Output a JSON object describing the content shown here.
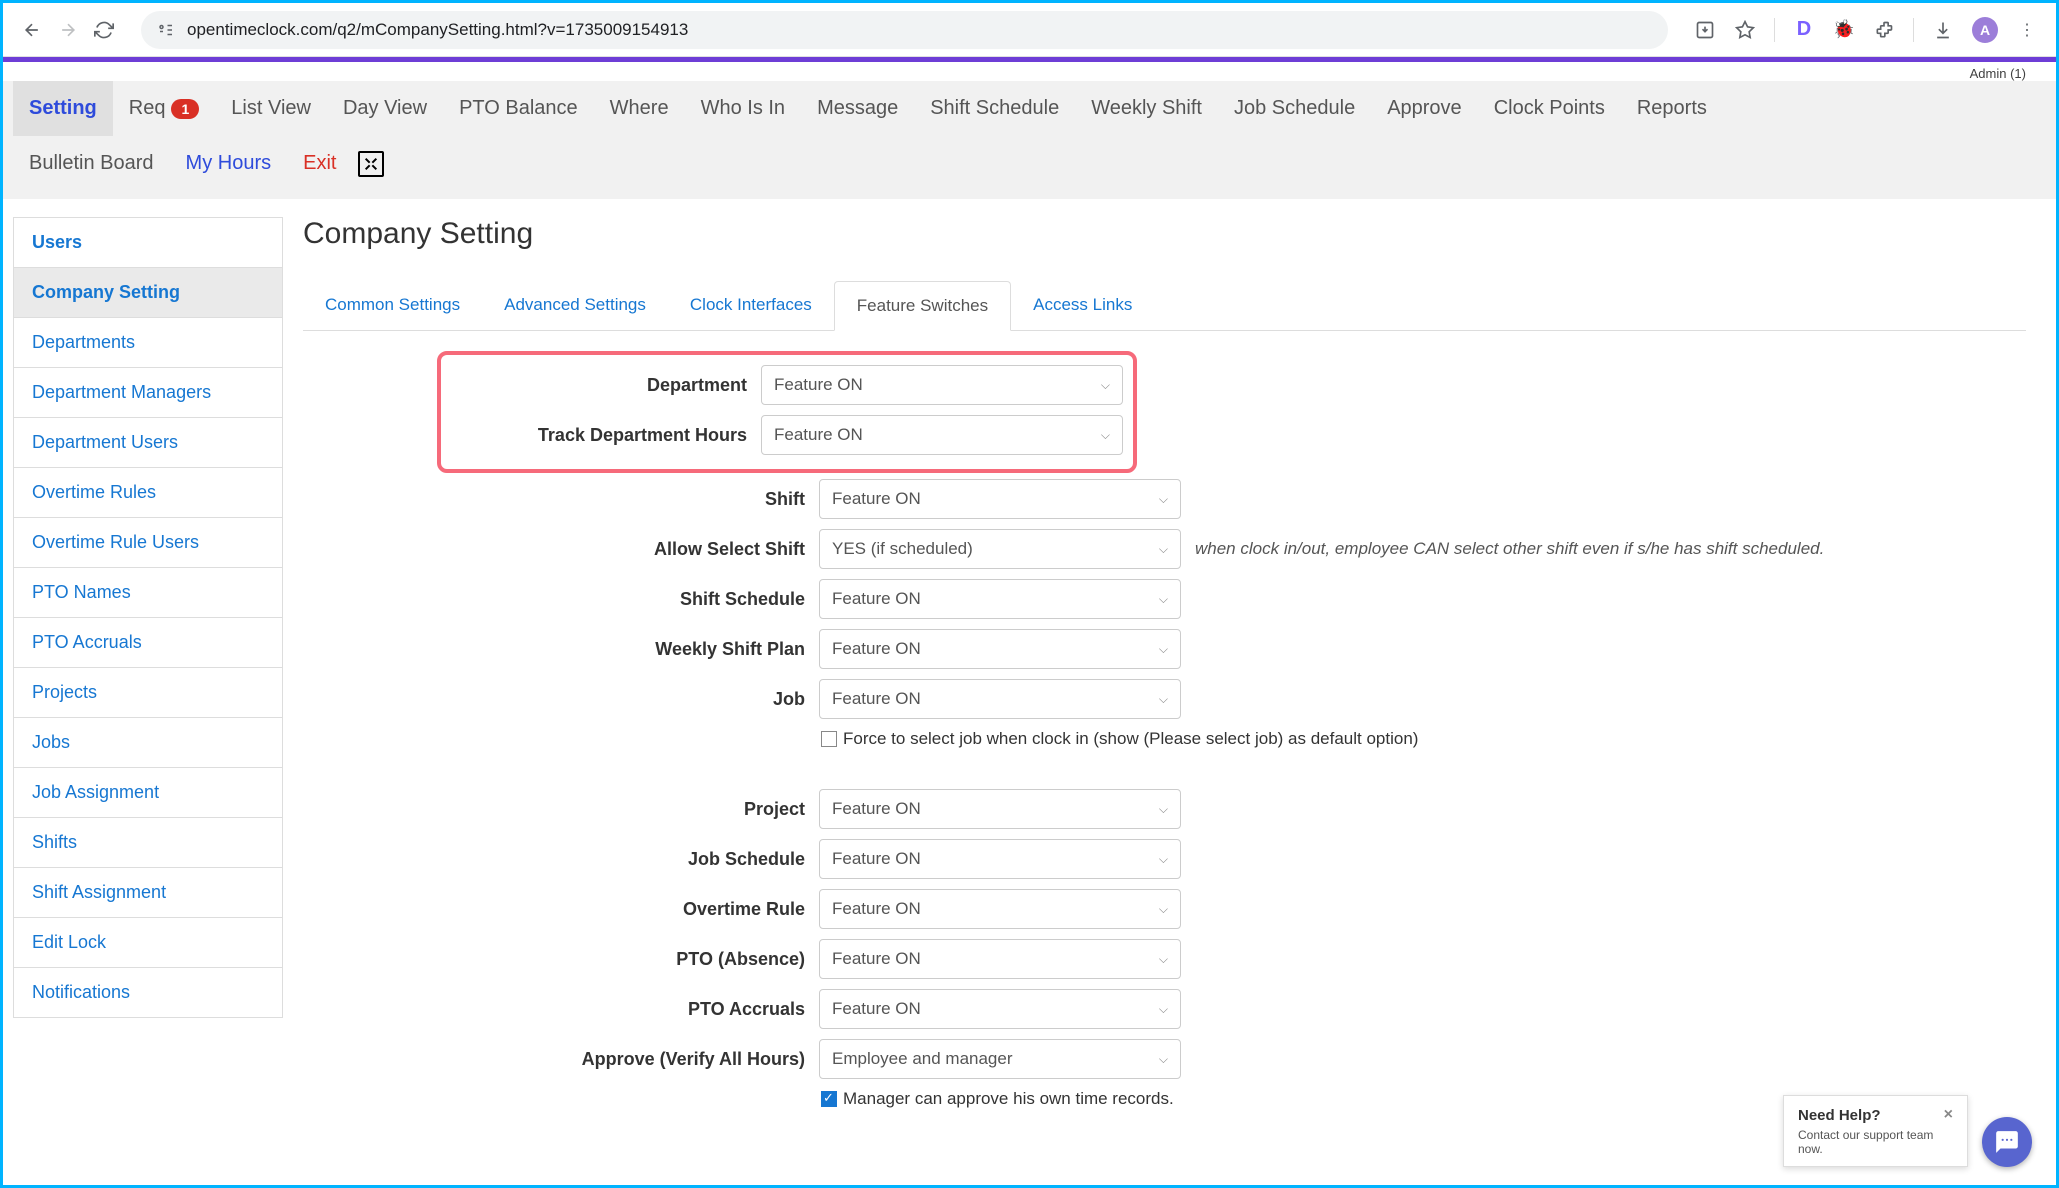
{
  "browser": {
    "url": "opentimeclock.com/q2/mCompanySetting.html?v=1735009154913",
    "dIcon": "D",
    "avatarLetter": "A"
  },
  "adminLabel": "Admin (1)",
  "topNav": [
    {
      "label": "Setting",
      "active": true
    },
    {
      "label": "Req",
      "badge": "1"
    },
    {
      "label": "List View"
    },
    {
      "label": "Day View"
    },
    {
      "label": "PTO Balance"
    },
    {
      "label": "Where"
    },
    {
      "label": "Who Is In"
    },
    {
      "label": "Message"
    },
    {
      "label": "Shift Schedule"
    },
    {
      "label": "Weekly Shift"
    },
    {
      "label": "Job Schedule"
    },
    {
      "label": "Approve"
    },
    {
      "label": "Clock Points"
    },
    {
      "label": "Reports"
    }
  ],
  "topNav2": [
    {
      "label": "Bulletin Board"
    },
    {
      "label": "My Hours",
      "blue": true
    },
    {
      "label": "Exit",
      "red": true
    }
  ],
  "sidebar": [
    "Users",
    "Company Setting",
    "Departments",
    "Department Managers",
    "Department Users",
    "Overtime Rules",
    "Overtime Rule Users",
    "PTO Names",
    "PTO Accruals",
    "Projects",
    "Jobs",
    "Job Assignment",
    "Shifts",
    "Shift Assignment",
    "Edit Lock",
    "Notifications"
  ],
  "sidebarActiveIndex": 1,
  "pageTitle": "Company Setting",
  "tabs": [
    "Common Settings",
    "Advanced Settings",
    "Clock Interfaces",
    "Feature Switches",
    "Access Links"
  ],
  "tabActiveIndex": 3,
  "fields": {
    "department": {
      "label": "Department",
      "value": "Feature ON"
    },
    "trackDept": {
      "label": "Track Department Hours",
      "value": "Feature ON"
    },
    "shift": {
      "label": "Shift",
      "value": "Feature ON"
    },
    "allowSelectShift": {
      "label": "Allow Select Shift",
      "value": "YES (if scheduled)",
      "helper": "when clock in/out, employee CAN select other shift even if s/he has shift scheduled."
    },
    "shiftSchedule": {
      "label": "Shift Schedule",
      "value": "Feature ON"
    },
    "weeklyShiftPlan": {
      "label": "Weekly Shift Plan",
      "value": "Feature ON"
    },
    "job": {
      "label": "Job",
      "value": "Feature ON"
    },
    "jobCheckbox": "Force to select job when clock in (show (Please select job) as default option)",
    "project": {
      "label": "Project",
      "value": "Feature ON"
    },
    "jobSchedule": {
      "label": "Job Schedule",
      "value": "Feature ON"
    },
    "overtimeRule": {
      "label": "Overtime Rule",
      "value": "Feature ON"
    },
    "ptoAbsence": {
      "label": "PTO (Absence)",
      "value": "Feature ON"
    },
    "ptoAccruals": {
      "label": "PTO Accruals",
      "value": "Feature ON"
    },
    "approve": {
      "label": "Approve (Verify All Hours)",
      "value": "Employee and manager"
    },
    "managerCheckbox": "Manager can approve his own time records."
  },
  "help": {
    "title": "Need Help?",
    "sub": "Contact our support team now."
  }
}
